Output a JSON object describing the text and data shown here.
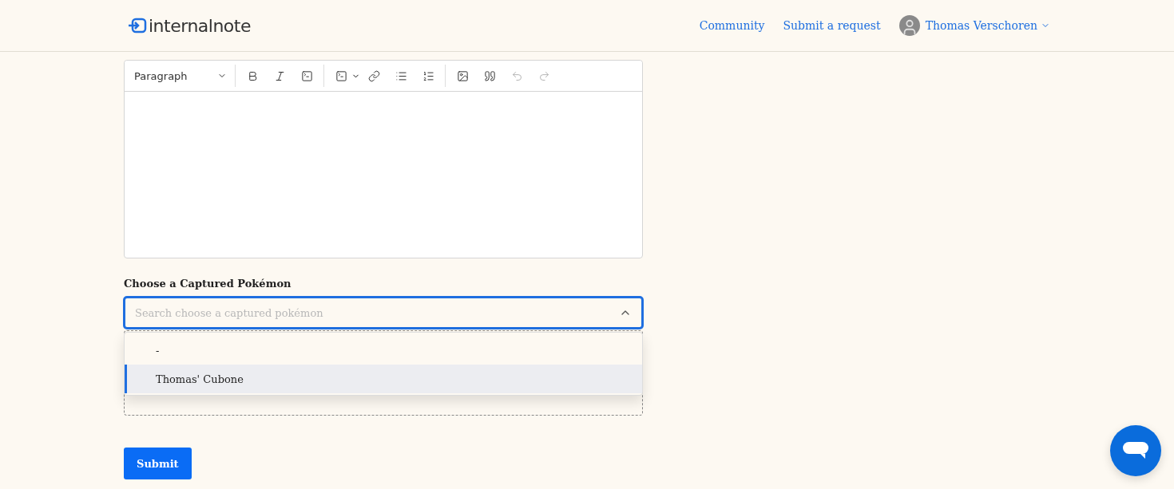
{
  "header": {
    "logo": "internalnote",
    "nav": [
      {
        "label": "Community"
      },
      {
        "label": "Submit a request"
      }
    ],
    "user": {
      "name": "Thomas Verschoren"
    }
  },
  "editor": {
    "format": "Paragraph",
    "tool_groups": [
      [
        {
          "kind": "bold",
          "disabled": false
        },
        {
          "kind": "italic",
          "disabled": false
        },
        {
          "kind": "code",
          "disabled": false
        }
      ],
      [
        {
          "kind": "codeblock",
          "disabled": false
        },
        {
          "kind": "link",
          "disabled": false
        },
        {
          "kind": "bulleted-list",
          "disabled": false
        },
        {
          "kind": "numbered-list",
          "disabled": false
        }
      ],
      [
        {
          "kind": "image",
          "disabled": false
        },
        {
          "kind": "quote",
          "disabled": false
        },
        {
          "kind": "undo",
          "disabled": true
        },
        {
          "kind": "redo",
          "disabled": true
        }
      ]
    ]
  },
  "pokemon_field": {
    "label": "Choose a Captured Pokémon",
    "placeholder": "Search choose a captured pokémon",
    "expanded": true,
    "options": [
      {
        "label": "-",
        "selected": false
      },
      {
        "label": "Thomas' Cubone",
        "selected": true
      }
    ]
  },
  "submit": {
    "label": "Submit"
  }
}
